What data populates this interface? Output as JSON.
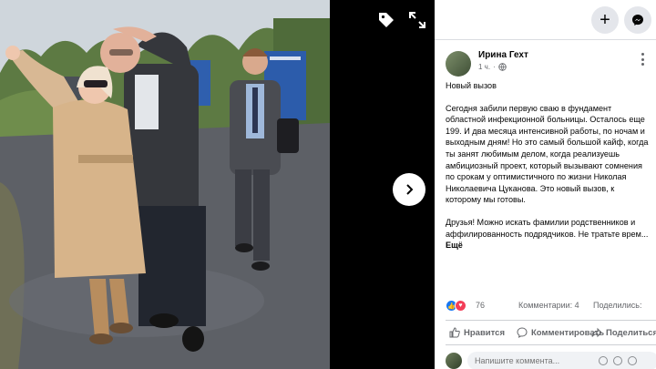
{
  "post": {
    "author_name": "Ирина Гехт",
    "time": "1 ч.",
    "title": "Новый вызов",
    "paragraph_1": "Сегодня забили первую сваю в фундамент областной инфекционной больницы. Осталось еще 199. И два месяца интенсивной работы, по ночам и выходным дням! Но это самый большой кайф, когда ты занят любимым делом, когда реализуешь амбициозный проект, который вызывают сомнения по срокам у оптимистичного по жизни Николая Николаевича Цуканова. Это новый вызов, к которому мы готовы.",
    "paragraph_2": "Друзья! Можно искать фамилии родственников и аффилированность подрядчиков. Не тратьте врем...",
    "see_more": "Ещё"
  },
  "engagement": {
    "reaction_count": "76",
    "comments": "Комментарии: 4",
    "shares": "Поделились:"
  },
  "actions": {
    "like": "Нравится",
    "comment": "Комментировать",
    "share": "Поделиться"
  },
  "composer": {
    "placeholder": "Напишите коммента..."
  },
  "topbar": {
    "add_label": "+"
  },
  "colors": {
    "facebook_blue": "#1877f2",
    "love_red": "#f33e58",
    "secondary_text": "#65676b"
  },
  "icons": [
    "tag-icon",
    "expand-icon",
    "chevron-right-icon",
    "plus-icon",
    "messenger-icon",
    "globe-icon",
    "more-options-icon",
    "like-icon",
    "comment-icon",
    "share-icon"
  ]
}
